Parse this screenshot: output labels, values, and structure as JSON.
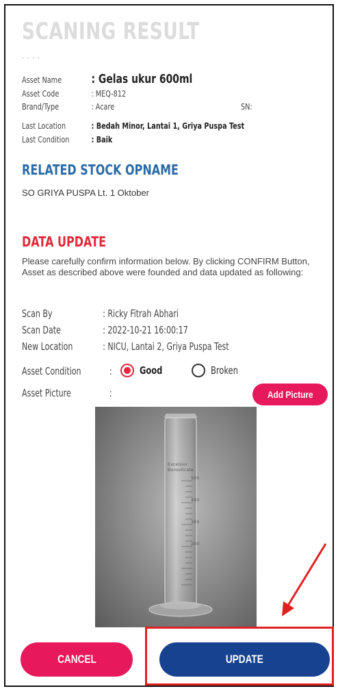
{
  "header": {
    "title": "SCANING RESULT",
    "cut_text": "·   ·           ·    ·"
  },
  "asset": {
    "name_label": "Asset Name",
    "name_value": ": Gelas ukur 600ml",
    "code_label": "Asset Code",
    "code_value": ": MEQ-812",
    "brand_label": "Brand/Type",
    "brand_value": ": Acare",
    "sn_label": "SN:",
    "location_label": "Last Location",
    "location_value": ": Bedah Minor, Lantai 1, Griya Puspa Test",
    "condition_label": "Last Condition",
    "condition_value": ": Baik"
  },
  "related": {
    "title": "RELATED STOCK OPNAME",
    "value": "SO GRIYA PUSPA Lt. 1 Oktober"
  },
  "data_update": {
    "title": "DATA UPDATE",
    "instructions": "Please carefully confirm information below. By clicking CONFIRM Button, Asset as described above were founded and data updated as following:",
    "scan_by_label": "Scan By",
    "scan_by_value": ": Ricky Fitrah Abhari",
    "scan_date_label": "Scan Date",
    "scan_date_value": ": 2022-10-21 16:00:17",
    "new_location_label": "New Location",
    "new_location_value": ": NICU, Lantai 2, Griya Puspa Test",
    "condition_label": "Asset Condition",
    "condition_sep": ":",
    "condition_options": [
      {
        "label": "Good",
        "selected": true
      },
      {
        "label": "Broken",
        "selected": false
      }
    ],
    "picture_label": "Asset Picture",
    "picture_sep": ":",
    "add_picture_label": "Add Picture",
    "beaker_marks": [
      "Excelsior",
      "Borosilicate",
      "500",
      "400",
      "300",
      "200"
    ]
  },
  "actions": {
    "cancel_label": "CANCEL",
    "update_label": "UPDATE"
  },
  "colors": {
    "accent_pink": "#e8185c",
    "primary_blue": "#17428f",
    "section_blue": "#2a6aa7",
    "section_red": "#e0293a",
    "annotation_red": "#e02020"
  },
  "icons": {
    "radio_selected": "radio-selected-icon",
    "radio_unselected": "radio-unselected-icon",
    "annotation": "red-arrow-icon"
  }
}
